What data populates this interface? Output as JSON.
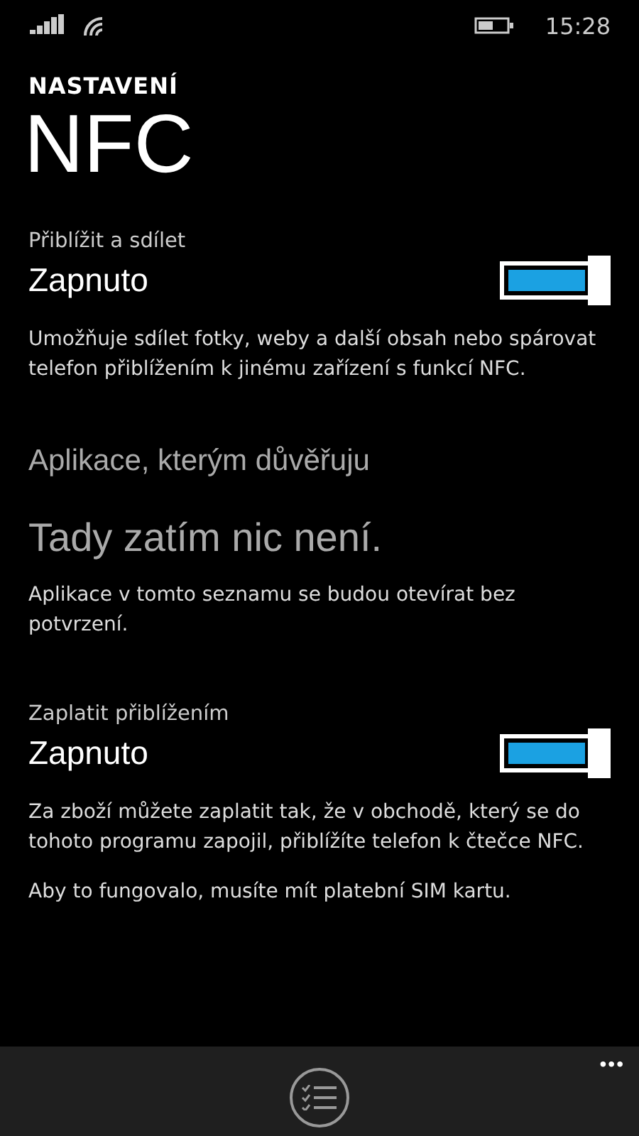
{
  "status_bar": {
    "time": "15:28"
  },
  "header": {
    "subtitle": "NASTAVENÍ",
    "title": "NFC"
  },
  "sections": [
    {
      "kind": "toggle",
      "label": "Přiblížit a sdílet",
      "value": "Zapnuto",
      "on": true,
      "description": [
        "Umožňuje sdílet fotky, weby a další obsah nebo spárovat telefon přiblížením k jinému zařízení s funkcí NFC."
      ]
    },
    {
      "kind": "list",
      "heading": "Aplikace, kterým důvěřuju",
      "empty": "Tady zatím nic není.",
      "description": [
        "Aplikace v tomto seznamu se budou otevírat bez potvrzení."
      ]
    },
    {
      "kind": "toggle",
      "label": "Zaplatit přiblížením",
      "value": "Zapnuto",
      "on": true,
      "description": [
        "Za zboží můžete zaplatit tak, že v obchodě, který se do tohoto programu zapojil, přiblížíte telefon k čtečce NFC.",
        "Aby to fungovalo, musíte mít platební SIM kartu."
      ]
    }
  ],
  "app_bar": {
    "more": "•••"
  }
}
